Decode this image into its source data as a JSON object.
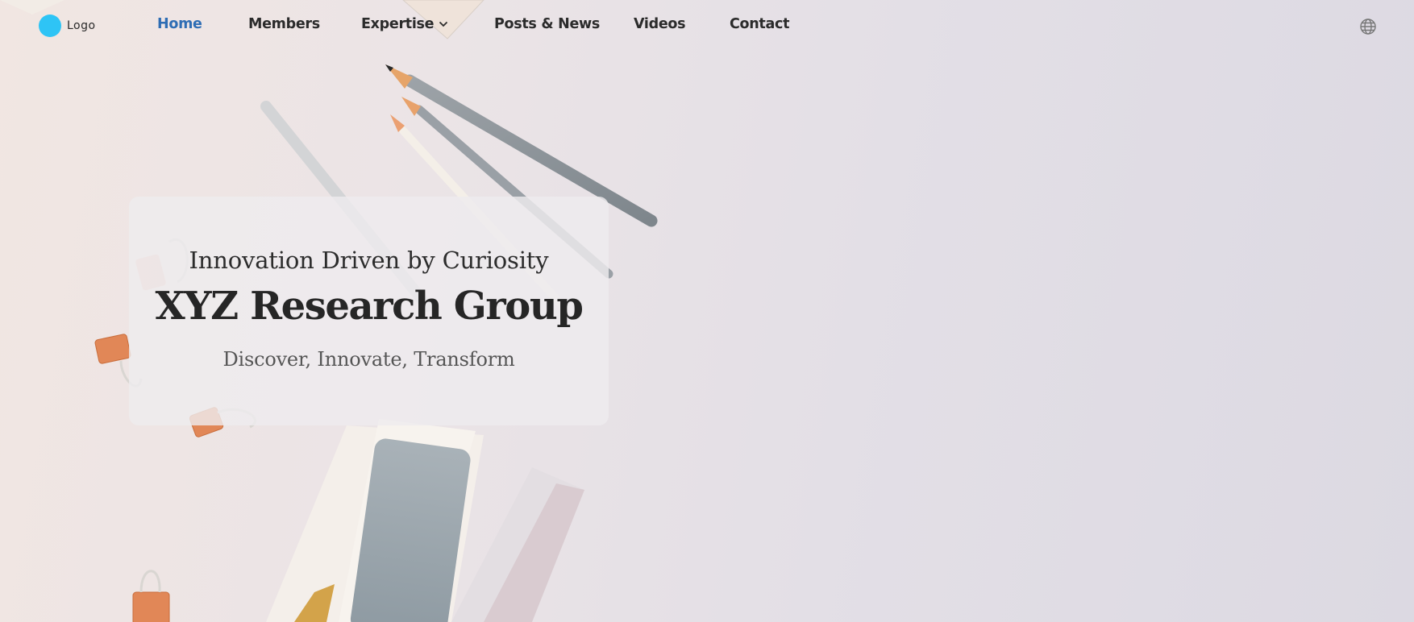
{
  "nav": {
    "logo_text": "Logo",
    "items": [
      {
        "label": "Home",
        "active": true
      },
      {
        "label": "Members"
      },
      {
        "label": "Expertise",
        "has_dropdown": true
      },
      {
        "label": "Posts & News"
      },
      {
        "label": "Videos"
      },
      {
        "label": "Contact"
      }
    ],
    "language_icon": "globe-icon"
  },
  "hero": {
    "tagline": "Innovation Driven by Curiosity",
    "title": "XYZ Research Group",
    "subtitle": "Discover, Innovate, Transform"
  },
  "colors": {
    "accent": "#2e6db4",
    "logo_dot": "#2ec4f5",
    "nav_text": "#2b2b2b"
  }
}
